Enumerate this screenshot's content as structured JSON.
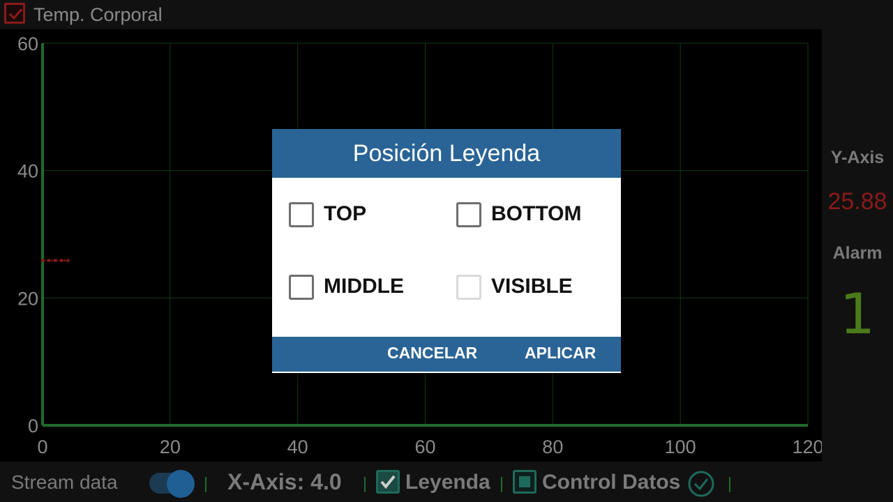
{
  "header": {
    "checkbox_checked": true,
    "title": "Temp. Corporal"
  },
  "right_panel": {
    "y_axis_label": "Y-Axis",
    "y_axis_value": "25.88",
    "alarm_label": "Alarm",
    "alarm_value": "1"
  },
  "chart_data": {
    "type": "line",
    "title": "",
    "xlabel": "",
    "ylabel": "",
    "xlim": [
      0,
      120
    ],
    "ylim": [
      0,
      60
    ],
    "x_ticks": [
      "0",
      "20",
      "40",
      "60",
      "80",
      "100",
      "120"
    ],
    "y_ticks": [
      "0",
      "20",
      "40",
      "60"
    ],
    "grid": true,
    "series": [
      {
        "color": "#8b1a1a",
        "x": [
          0,
          1,
          2,
          3,
          4
        ],
        "y": [
          25.88,
          25.88,
          25.88,
          25.88,
          25.88
        ]
      }
    ]
  },
  "dialog": {
    "title": "Posición Leyenda",
    "options": [
      {
        "label": "TOP",
        "checked": false,
        "enabled": true
      },
      {
        "label": "BOTTOM",
        "checked": false,
        "enabled": true
      },
      {
        "label": "MIDDLE",
        "checked": false,
        "enabled": true
      },
      {
        "label": "VISIBLE",
        "checked": false,
        "enabled": false
      }
    ],
    "cancel_label": "CANCELAR",
    "apply_label": "APLICAR"
  },
  "bottom_bar": {
    "stream_label": "Stream data",
    "stream_on": true,
    "x_axis_label": "X-Axis: 4.0",
    "legend_label": "Leyenda",
    "legend_checked": true,
    "control_label": "Control Datos",
    "control_state": "indeterminate"
  },
  "colors": {
    "dialog_accent": "#2a6496",
    "grid": "#0f3a14",
    "axis": "#1f6b2a",
    "series": "#8b1a1a",
    "alarm": "#4a7a1a",
    "check_teal": "#1e6a5c"
  }
}
